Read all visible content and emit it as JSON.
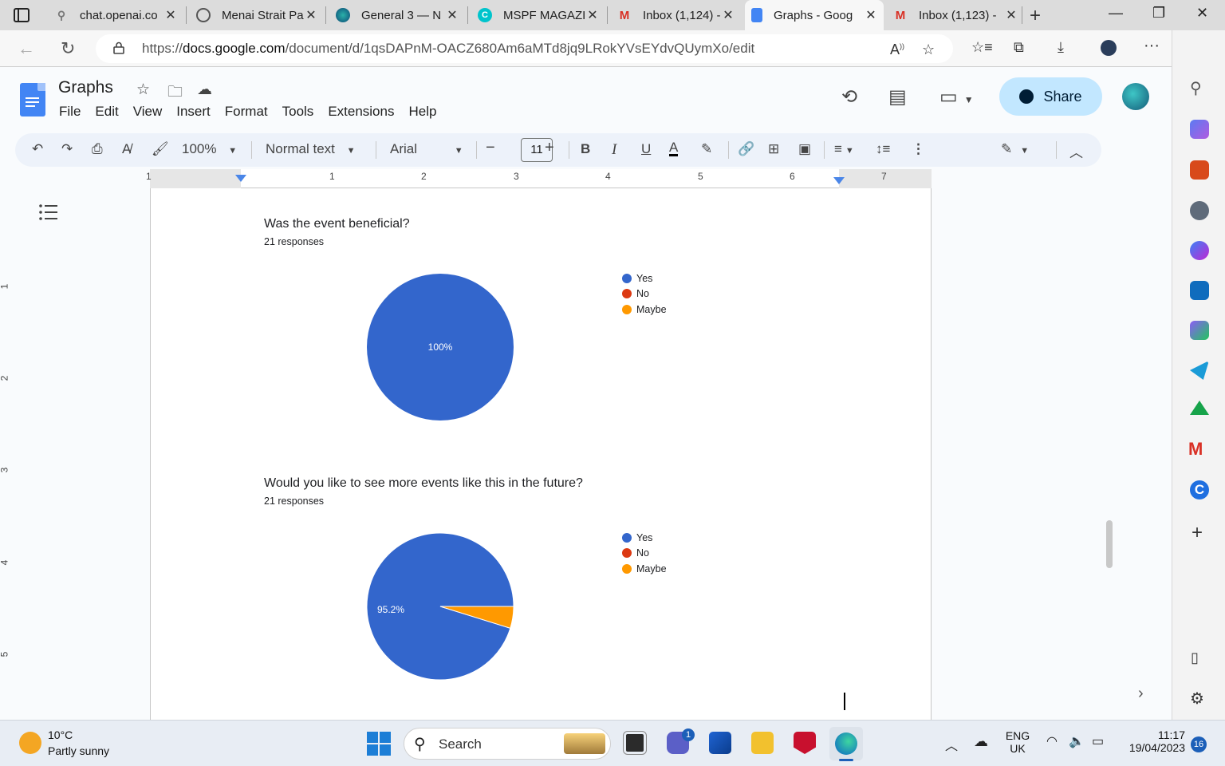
{
  "browser": {
    "tabs": [
      {
        "title": "chat.openai.co",
        "icon": "search-icon"
      },
      {
        "title": "Menai Strait Pa",
        "icon": "chatgpt-icon"
      },
      {
        "title": "General 3 — N",
        "icon": "edge-icon"
      },
      {
        "title": "MSPF MAGAZI",
        "icon": "canva-icon"
      },
      {
        "title": "Inbox (1,124) -",
        "icon": "gmail-icon"
      },
      {
        "title": "Graphs - Goog",
        "icon": "docs-icon",
        "active": true
      },
      {
        "title": "Inbox (1,123) -",
        "icon": "gmail-icon"
      }
    ],
    "url_prefix": "https://",
    "url_host": "docs.google.com",
    "url_path": "/document/d/1qsDAPnM-OACZ680Am6aMTd8jq9LRokYVsEYdvQUymXo/edit"
  },
  "docs": {
    "title": "Graphs",
    "menu": [
      "File",
      "Edit",
      "View",
      "Insert",
      "Format",
      "Tools",
      "Extensions",
      "Help"
    ],
    "share_label": "Share",
    "toolbar": {
      "zoom": "100%",
      "style": "Normal text",
      "font": "Arial",
      "font_size": "11"
    },
    "ruler_numbers": [
      "1",
      "1",
      "2",
      "3",
      "4",
      "5",
      "6",
      "7"
    ],
    "vruler_numbers": [
      "1",
      "2",
      "3",
      "4",
      "5"
    ]
  },
  "charts": [
    {
      "question": "Was the event beneficial?",
      "responses": "21 responses",
      "slice_label": "100%",
      "legend": [
        "Yes",
        "No",
        "Maybe"
      ]
    },
    {
      "question": "Would you like to see more events like this in the future?",
      "responses": "21 responses",
      "slice_label": "95.2%",
      "legend": [
        "Yes",
        "No",
        "Maybe"
      ]
    }
  ],
  "chart_data": [
    {
      "type": "pie",
      "title": "Was the event beneficial?",
      "categories": [
        "Yes",
        "No",
        "Maybe"
      ],
      "values": [
        100,
        0,
        0
      ],
      "colors": [
        "#3366cc",
        "#dc3912",
        "#ff9900"
      ],
      "legend": "right"
    },
    {
      "type": "pie",
      "title": "Would you like to see more events like this in the future?",
      "categories": [
        "Yes",
        "No",
        "Maybe"
      ],
      "values": [
        95.2,
        0,
        4.8
      ],
      "colors": [
        "#3366cc",
        "#dc3912",
        "#ff9900"
      ],
      "legend": "right"
    }
  ],
  "taskbar": {
    "weather_temp": "10°C",
    "weather_desc": "Partly sunny",
    "search_label": "Search",
    "teams_badge": "1",
    "lang_top": "ENG",
    "lang_bottom": "UK",
    "time": "11:17",
    "date": "19/04/2023",
    "notifications": "16"
  }
}
